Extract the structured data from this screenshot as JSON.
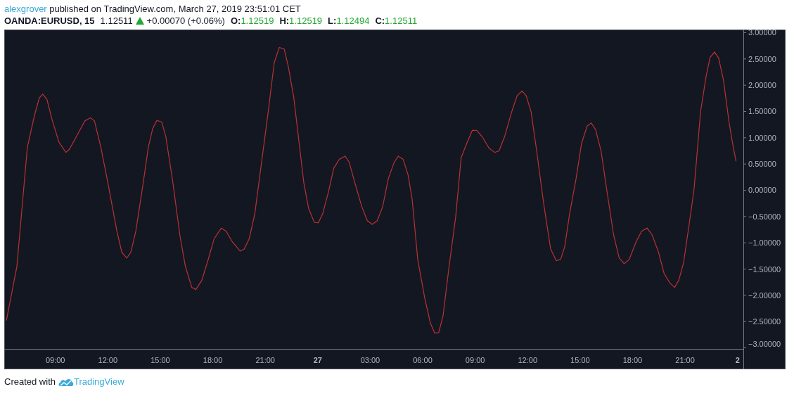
{
  "header": {
    "author": "alexgrover",
    "published": "published on TradingView.com, March 27, 2019 23:51:01 CET"
  },
  "symbol_bar": {
    "symbol": "OANDA:EURUSD, 15",
    "price": "1.12511",
    "change": "+0.00070 (+0.06%)",
    "ohlc": [
      {
        "label": "O:",
        "value": "1.12519"
      },
      {
        "label": "H:",
        "value": "1.12519"
      },
      {
        "label": "L:",
        "value": "1.12494"
      },
      {
        "label": "C:",
        "value": "1.12511"
      }
    ]
  },
  "chart": {
    "chart_data": {
      "type": "line",
      "xlim": [
        "2019-03-26T06:07",
        "2019-03-28T00:20"
      ],
      "ylim": [
        -3.02,
        3.06
      ],
      "xticks": [
        {
          "value": "2019-03-26T09:00",
          "label": "09:00"
        },
        {
          "value": "2019-03-26T12:00",
          "label": "12:00"
        },
        {
          "value": "2019-03-26T15:00",
          "label": "15:00"
        },
        {
          "value": "2019-03-26T18:00",
          "label": "18:00"
        },
        {
          "value": "2019-03-26T21:00",
          "label": "21:00"
        },
        {
          "value": "2019-03-27T00:00",
          "label": "27"
        },
        {
          "value": "2019-03-27T03:00",
          "label": "03:00"
        },
        {
          "value": "2019-03-27T06:00",
          "label": "06:00"
        },
        {
          "value": "2019-03-27T09:00",
          "label": "09:00"
        },
        {
          "value": "2019-03-27T12:00",
          "label": "12:00"
        },
        {
          "value": "2019-03-27T15:00",
          "label": "15:00"
        },
        {
          "value": "2019-03-27T18:00",
          "label": "18:00"
        },
        {
          "value": "2019-03-27T21:00",
          "label": "21:00"
        },
        {
          "value": "2019-03-28T00:00",
          "label": "2"
        }
      ],
      "yticks": [
        {
          "value": 3,
          "label": "3.00000"
        },
        {
          "value": 2.5,
          "label": "2.50000"
        },
        {
          "value": 2,
          "label": "2.00000"
        },
        {
          "value": 1.5,
          "label": "1.50000"
        },
        {
          "value": 1,
          "label": "1.00000"
        },
        {
          "value": 0.5,
          "label": "0.50000"
        },
        {
          "value": 0,
          "label": "0.00000"
        },
        {
          "value": -0.5,
          "label": "−0.50000"
        },
        {
          "value": -1,
          "label": "−1.00000"
        },
        {
          "value": -1.5,
          "label": "−1.50000"
        },
        {
          "value": -2,
          "label": "−2.00000"
        },
        {
          "value": -2.5,
          "label": "−2.50000"
        },
        {
          "value": -3,
          "label": "−3.00000"
        }
      ],
      "x": [
        "2019-03-26T06:12",
        "2019-03-26T06:48",
        "2019-03-26T07:24",
        "2019-03-26T07:48",
        "2019-03-26T08:05",
        "2019-03-26T08:17",
        "2019-03-26T08:31",
        "2019-03-26T08:48",
        "2019-03-26T09:12",
        "2019-03-26T09:36",
        "2019-03-26T09:48",
        "2019-03-26T10:12",
        "2019-03-26T10:41",
        "2019-03-26T11:00",
        "2019-03-26T11:14",
        "2019-03-26T11:36",
        "2019-03-26T12:00",
        "2019-03-26T12:31",
        "2019-03-26T12:48",
        "2019-03-26T13:05",
        "2019-03-26T13:19",
        "2019-03-26T13:36",
        "2019-03-26T14:00",
        "2019-03-26T14:19",
        "2019-03-26T14:34",
        "2019-03-26T14:48",
        "2019-03-26T15:05",
        "2019-03-26T15:19",
        "2019-03-26T15:43",
        "2019-03-26T16:07",
        "2019-03-26T16:26",
        "2019-03-26T16:48",
        "2019-03-26T17:02",
        "2019-03-26T17:22",
        "2019-03-26T17:41",
        "2019-03-26T18:05",
        "2019-03-26T18:29",
        "2019-03-26T18:46",
        "2019-03-26T19:07",
        "2019-03-26T19:34",
        "2019-03-26T19:48",
        "2019-03-26T20:05",
        "2019-03-26T20:24",
        "2019-03-26T20:43",
        "2019-03-26T21:07",
        "2019-03-26T21:31",
        "2019-03-26T21:48",
        "2019-03-26T22:05",
        "2019-03-26T22:19",
        "2019-03-26T22:38",
        "2019-03-26T22:55",
        "2019-03-26T23:12",
        "2019-03-26T23:29",
        "2019-03-26T23:48",
        "2019-03-27T00:02",
        "2019-03-27T00:17",
        "2019-03-27T00:36",
        "2019-03-27T00:55",
        "2019-03-27T01:14",
        "2019-03-27T01:34",
        "2019-03-27T01:48",
        "2019-03-27T02:07",
        "2019-03-27T02:31",
        "2019-03-27T02:50",
        "2019-03-27T03:07",
        "2019-03-27T03:24",
        "2019-03-27T03:43",
        "2019-03-27T04:02",
        "2019-03-27T04:22",
        "2019-03-27T04:36",
        "2019-03-27T04:53",
        "2019-03-27T05:10",
        "2019-03-27T05:24",
        "2019-03-27T05:43",
        "2019-03-27T06:07",
        "2019-03-27T06:26",
        "2019-03-27T06:41",
        "2019-03-27T06:55",
        "2019-03-27T07:10",
        "2019-03-27T07:29",
        "2019-03-27T07:53",
        "2019-03-27T08:12",
        "2019-03-27T08:31",
        "2019-03-27T08:50",
        "2019-03-27T09:05",
        "2019-03-27T09:24",
        "2019-03-27T09:48",
        "2019-03-27T10:07",
        "2019-03-27T10:22",
        "2019-03-27T10:41",
        "2019-03-27T11:05",
        "2019-03-27T11:24",
        "2019-03-27T11:41",
        "2019-03-27T11:55",
        "2019-03-27T12:12",
        "2019-03-27T12:31",
        "2019-03-27T12:55",
        "2019-03-27T13:19",
        "2019-03-27T13:38",
        "2019-03-27T13:53",
        "2019-03-27T14:07",
        "2019-03-27T14:24",
        "2019-03-27T14:46",
        "2019-03-27T15:05",
        "2019-03-27T15:24",
        "2019-03-27T15:38",
        "2019-03-27T15:53",
        "2019-03-27T16:12",
        "2019-03-27T16:31",
        "2019-03-27T16:55",
        "2019-03-27T17:14",
        "2019-03-27T17:31",
        "2019-03-27T17:48",
        "2019-03-27T18:12",
        "2019-03-27T18:31",
        "2019-03-27T18:50",
        "2019-03-27T19:07",
        "2019-03-27T19:29",
        "2019-03-27T19:48",
        "2019-03-27T20:07",
        "2019-03-27T20:24",
        "2019-03-27T20:38",
        "2019-03-27T20:55",
        "2019-03-27T21:14",
        "2019-03-27T21:31",
        "2019-03-27T21:53",
        "2019-03-27T22:12",
        "2019-03-27T22:26",
        "2019-03-27T22:41",
        "2019-03-27T22:55",
        "2019-03-27T23:12",
        "2019-03-27T23:31",
        "2019-03-27T23:43",
        "2019-03-27T23:55"
      ],
      "series": [
        {
          "color": "#b93232",
          "values": [
            -2.48,
            -1.45,
            0.82,
            1.42,
            1.76,
            1.83,
            1.73,
            1.36,
            0.92,
            0.72,
            0.78,
            1.02,
            1.32,
            1.38,
            1.32,
            0.82,
            0.15,
            -0.78,
            -1.18,
            -1.29,
            -1.18,
            -0.78,
            0.09,
            0.82,
            1.18,
            1.33,
            1.3,
            1.02,
            0.15,
            -0.85,
            -1.45,
            -1.85,
            -1.89,
            -1.72,
            -1.38,
            -0.92,
            -0.72,
            -0.78,
            -0.98,
            -1.16,
            -1.12,
            -0.92,
            -0.45,
            0.35,
            1.36,
            2.43,
            2.72,
            2.69,
            2.36,
            1.76,
            0.96,
            0.15,
            -0.35,
            -0.61,
            -0.62,
            -0.45,
            -0.05,
            0.42,
            0.59,
            0.65,
            0.53,
            0.15,
            -0.31,
            -0.58,
            -0.65,
            -0.58,
            -0.31,
            0.22,
            0.53,
            0.65,
            0.59,
            0.29,
            -0.18,
            -1.32,
            -2.05,
            -2.52,
            -2.72,
            -2.71,
            -2.39,
            -1.52,
            -0.51,
            0.62,
            0.89,
            1.14,
            1.14,
            1.02,
            0.8,
            0.72,
            0.75,
            1.02,
            1.49,
            1.8,
            1.89,
            1.8,
            1.49,
            0.75,
            -0.25,
            -1.12,
            -1.34,
            -1.32,
            -1.08,
            -0.45,
            0.22,
            0.89,
            1.22,
            1.28,
            1.16,
            0.75,
            0.02,
            -0.85,
            -1.29,
            -1.4,
            -1.32,
            -0.98,
            -0.78,
            -0.72,
            -0.85,
            -1.18,
            -1.58,
            -1.76,
            -1.85,
            -1.72,
            -1.38,
            -0.65,
            0.02,
            1.49,
            2.16,
            2.53,
            2.63,
            2.52,
            2.09,
            1.29,
            0.89,
            0.55
          ]
        }
      ]
    }
  },
  "footer": {
    "text": "Created with",
    "brand": "TradingView"
  }
}
